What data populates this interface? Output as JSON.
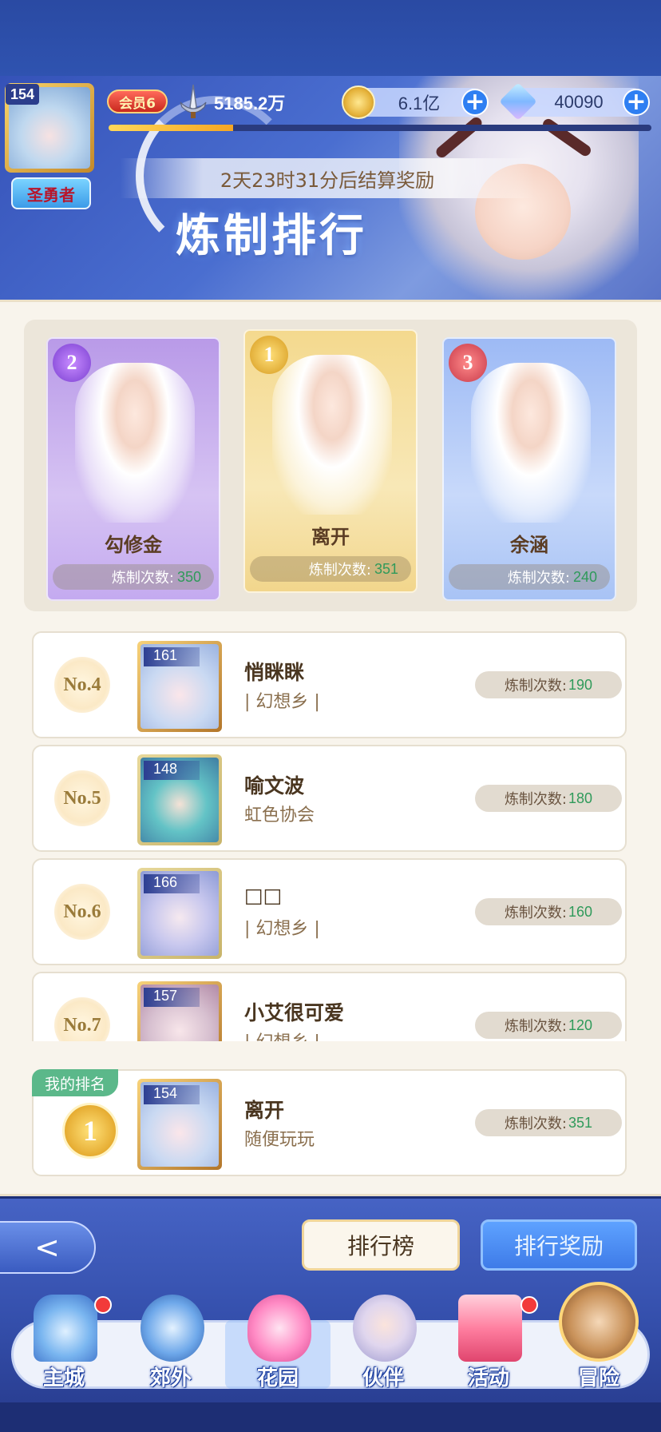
{
  "player": {
    "level": "154",
    "title": "圣勇者",
    "vip": "会员6",
    "power": "5185.2万",
    "exp_progress": 0.23
  },
  "resources": {
    "gold": "6.1亿",
    "gems": "40090"
  },
  "event": {
    "countdown": "2天23时31分后结算奖励",
    "title": "炼制排行"
  },
  "podium": [
    {
      "rank": "2",
      "name": "勾修金",
      "count_label": "炼制次数:",
      "count": "350"
    },
    {
      "rank": "1",
      "name": "离开",
      "count_label": "炼制次数:",
      "count": "351"
    },
    {
      "rank": "3",
      "name": "余涵",
      "count_label": "炼制次数:",
      "count": "240"
    }
  ],
  "ranking": [
    {
      "rank": "No.4",
      "level": "161",
      "name": "悄眯眯",
      "guild": "| 幻想乡 |",
      "count_label": "炼制次数:",
      "count": "190"
    },
    {
      "rank": "No.5",
      "level": "148",
      "name": "喻文波",
      "guild": "虹色协会",
      "count_label": "炼制次数:",
      "count": "180"
    },
    {
      "rank": "No.6",
      "level": "166",
      "name": "□□",
      "guild": "| 幻想乡 |",
      "count_label": "炼制次数:",
      "count": "160"
    },
    {
      "rank": "No.7",
      "level": "157",
      "name": "小艾很可爱",
      "guild": "| 幻想乡 |",
      "count_label": "炼制次数:",
      "count": "120"
    }
  ],
  "my_rank": {
    "tag": "我的排名",
    "rank": "1",
    "level": "154",
    "name": "离开",
    "guild": "随便玩玩",
    "count_label": "炼制次数:",
    "count": "351"
  },
  "buttons": {
    "back": "<",
    "leaderboard": "排行榜",
    "reward": "排行奖励"
  },
  "nav": [
    {
      "label": "主城",
      "icon": "castle-icon",
      "badge": true
    },
    {
      "label": "郊外",
      "icon": "compass-star-icon",
      "badge": false
    },
    {
      "label": "花园",
      "icon": "heart-icon",
      "badge": false
    },
    {
      "label": "伙伴",
      "icon": "partner-icon",
      "badge": false
    },
    {
      "label": "活动",
      "icon": "gift-icon",
      "badge": true
    },
    {
      "label": "冒险",
      "icon": "adventure-icon",
      "badge": false
    }
  ],
  "colors": {
    "accent_green": "#2f9a5a",
    "gold": "#e4a82c",
    "panel_bg": "#f8f4ec",
    "banner_blue": "#3552b8"
  }
}
